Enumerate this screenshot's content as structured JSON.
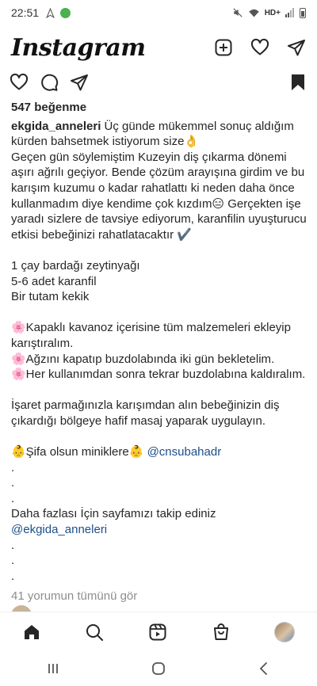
{
  "status": {
    "time": "22:51",
    "network": "HD+"
  },
  "header": {
    "logo": "Instagram"
  },
  "icons": {
    "new_post": "plus-square-icon",
    "activity": "heart-icon",
    "direct": "paper-plane-icon",
    "like": "heart-icon",
    "comment": "comment-icon",
    "share": "paper-plane-icon",
    "save": "bookmark-icon",
    "home": "home-icon",
    "search": "search-icon",
    "reels": "reels-icon",
    "shop": "shop-bag-icon"
  },
  "post": {
    "likes": "547 beğenme",
    "username": "ekgida_anneleri",
    "caption_first": " Üç günde mükemmel sonuç aldığım kürden bahsetmek istiyorum size👌",
    "para1": "Geçen gün söylemiştim Kuzeyin diş çıkarma dönemi aşırı ağrılı geçiyor. Bende çözüm arayışına girdim ve bu karışım kuzumu o kadar rahatlattı ki neden daha önce kullanmadım diye kendime çok kızdım😑 Gerçekten işe yaradı sizlere de tavsiye ediyorum, karanfilin uyuşturucu etkisi bebeğinizi rahatlatacaktır ✔️",
    "ingredients": [
      "1 çay bardağı zeytinyağı",
      "5-6 adet karanfil",
      "Bir tutam kekik"
    ],
    "steps": [
      "🌸Kapaklı kavanoz içerisine tüm malzemeleri ekleyip karıştıralım.",
      "🌸Ağzını kapatıp buzdolabında iki gün bekletelim.",
      "🌸Her kullanımdan sonra tekrar buzdolabına kaldıralım."
    ],
    "instruction": "İşaret parmağınızla karışımdan alın bebeğinizin diş çıkardığı bölgeye hafif masaj yaparak uygulayın.",
    "wish_text": "👶Şifa olsun miniklere👶 ",
    "wish_mention": "@cnsubahadr",
    "dot": ".",
    "follow_text": "Daha fazlası İçin sayfamızı takip ediniz",
    "follow_mention": "@ekgida_anneleri",
    "comments_link": "41 yorumun tümünü gör"
  }
}
